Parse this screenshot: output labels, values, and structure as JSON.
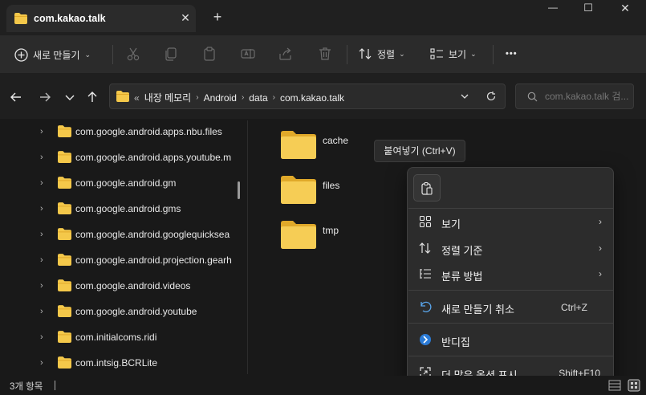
{
  "window": {
    "tab_title": "com.kakao.talk",
    "tab_close": "✕",
    "new_tab": "+",
    "minimize": "—",
    "maximize": "☐",
    "close": "✕"
  },
  "toolbar": {
    "new_label": "새로 만들기",
    "sort_label": "정렬",
    "view_label": "보기",
    "more_label": "•••"
  },
  "address": {
    "overflow": "«",
    "crumbs": [
      "내장 메모리",
      "Android",
      "data",
      "com.kakao.talk"
    ],
    "separator": "›"
  },
  "search": {
    "placeholder": "com.kakao.talk 검..."
  },
  "tree": {
    "items": [
      "com.google.android.apps.nbu.files",
      "com.google.android.apps.youtube.m",
      "com.google.android.gm",
      "com.google.android.gms",
      "com.google.android.googlequicksea",
      "com.google.android.projection.gearh",
      "com.google.android.videos",
      "com.google.android.youtube",
      "com.initialcoms.ridi",
      "com.intsig.BCRLite"
    ]
  },
  "files": [
    {
      "name": "cache",
      "icon": "folder-icon"
    },
    {
      "name": "files",
      "icon": "folder-icon"
    },
    {
      "name": "tmp",
      "icon": "folder-icon"
    }
  ],
  "tooltip": {
    "text": "붙여넣기 (Ctrl+V)"
  },
  "context_menu": {
    "paste_icon": "paste-icon",
    "items": [
      {
        "label": "보기",
        "shortcut": "",
        "submenu": true,
        "icon": "grid-icon"
      },
      {
        "label": "정렬 기준",
        "shortcut": "",
        "submenu": true,
        "icon": "sort-icon"
      },
      {
        "label": "분류 방법",
        "shortcut": "",
        "submenu": true,
        "icon": "group-icon"
      },
      {
        "label": "새로 만들기 취소",
        "shortcut": "Ctrl+Z",
        "submenu": false,
        "icon": "undo-icon"
      },
      {
        "label": "반디집",
        "shortcut": "",
        "submenu": false,
        "icon": "bandizip-icon"
      },
      {
        "label": "더 많은 옵션 표시",
        "shortcut": "Shift+F10",
        "submenu": false,
        "icon": "more-options-icon"
      }
    ],
    "submenu_arrow": "›"
  },
  "status": {
    "count": "3개 항목"
  },
  "colors": {
    "folder": "#f4c84a",
    "folder_dark": "#e0a92a",
    "accent": "#4c9ee8"
  }
}
